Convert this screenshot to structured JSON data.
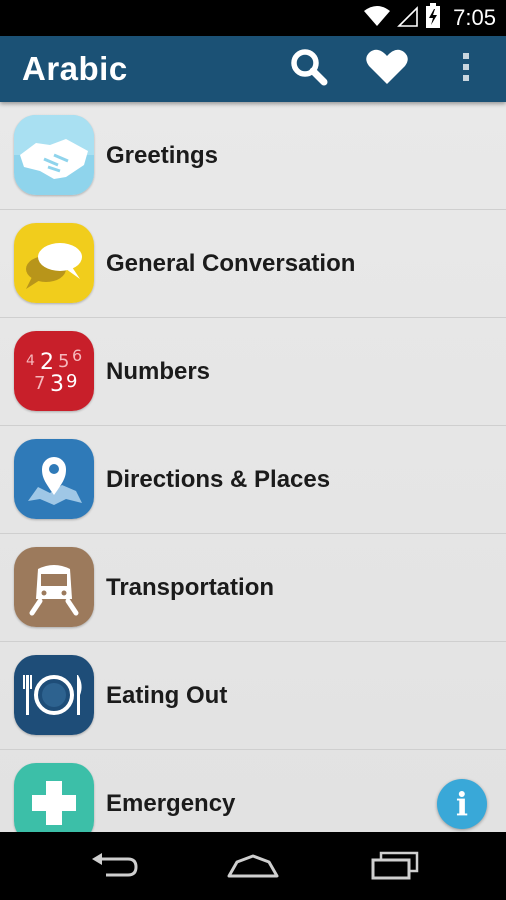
{
  "status_bar": {
    "time": "7:05",
    "icons": [
      "wifi-icon",
      "cell-signal-icon",
      "battery-charging-icon"
    ]
  },
  "app_bar": {
    "title": "Arabic",
    "actions": [
      "search-icon",
      "heart-icon",
      "overflow-menu-icon"
    ],
    "color": "#1b5175"
  },
  "categories": [
    {
      "label": "Greetings",
      "icon": "handshake-icon",
      "color": "#8fd4ec"
    },
    {
      "label": "General Conversation",
      "icon": "speech-bubbles-icon",
      "color": "#f1cd1c"
    },
    {
      "label": "Numbers",
      "icon": "numbers-icon",
      "color": "#c81f2a"
    },
    {
      "label": "Directions & Places",
      "icon": "map-pin-icon",
      "color": "#2f7ab8"
    },
    {
      "label": "Transportation",
      "icon": "train-icon",
      "color": "#9c7a5c"
    },
    {
      "label": "Eating Out",
      "icon": "plate-cutlery-icon",
      "color": "#1e4d78"
    },
    {
      "label": "Emergency",
      "icon": "medical-cross-icon",
      "color": "#3cbfa8"
    }
  ],
  "info_button": {
    "icon": "info-icon",
    "glyph": "i",
    "color": "#39a8d8"
  },
  "nav_bar": {
    "buttons": [
      "back-icon",
      "home-icon",
      "recent-apps-icon"
    ]
  }
}
